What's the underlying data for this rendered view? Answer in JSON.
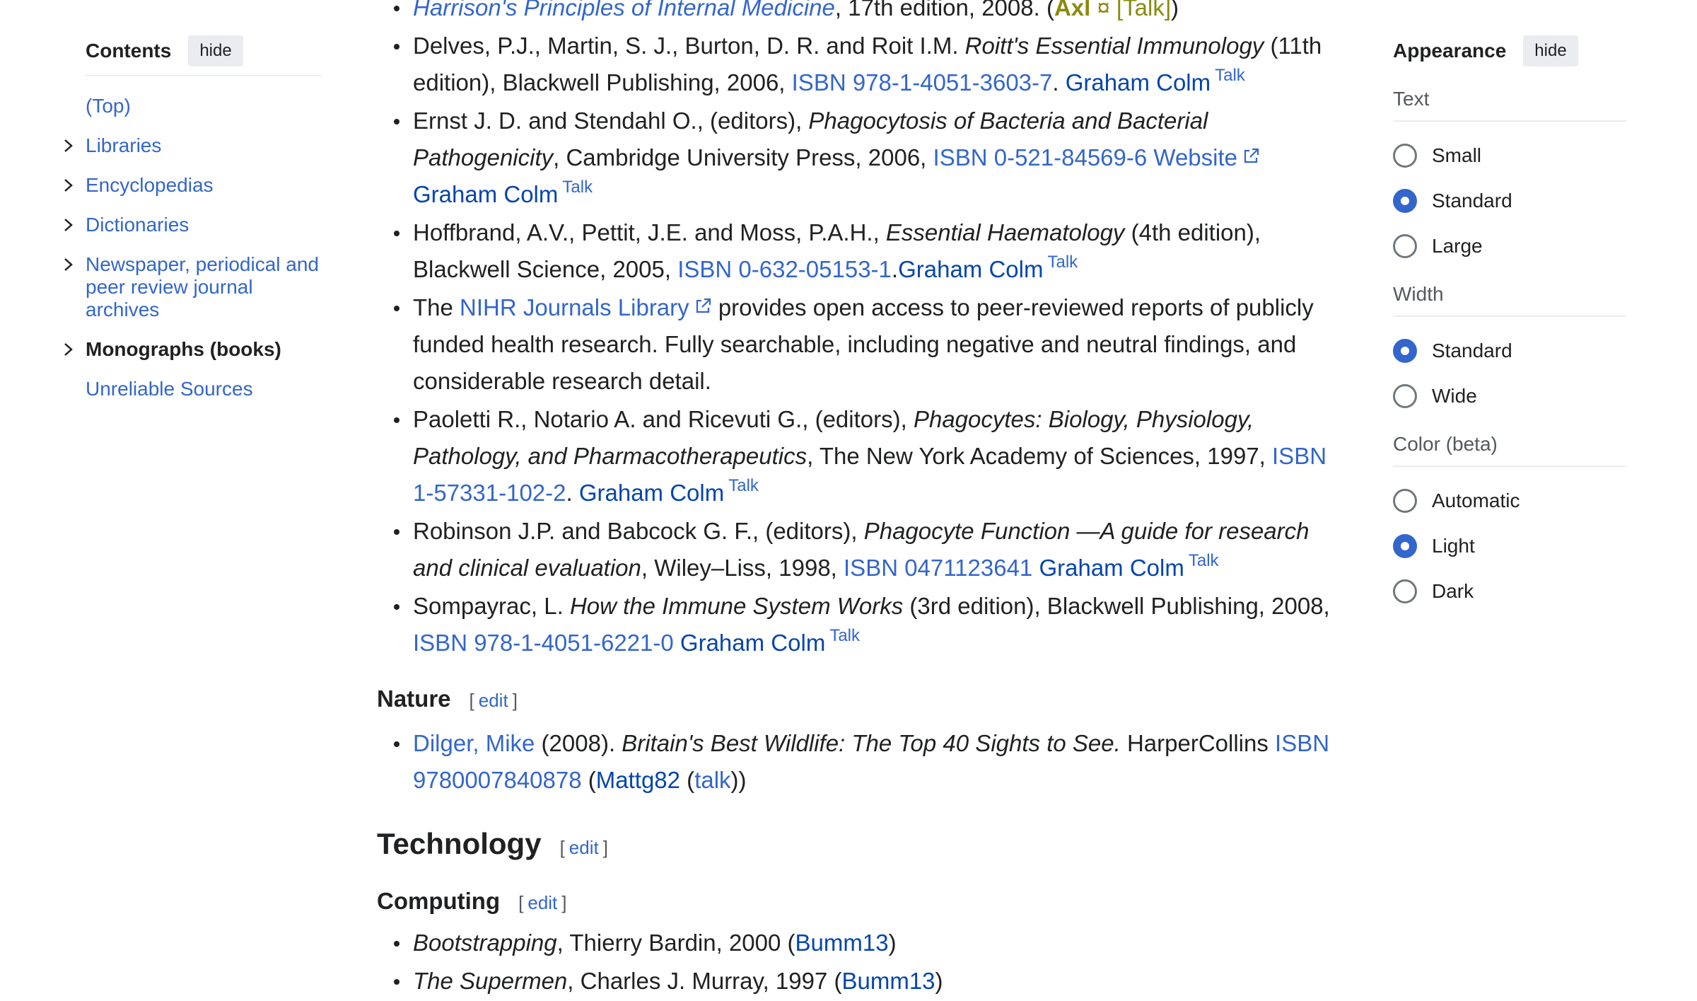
{
  "toc": {
    "title": "Contents",
    "hide_label": "hide",
    "items": [
      {
        "label": "(Top)"
      },
      {
        "label": "Libraries"
      },
      {
        "label": "Encyclopedias"
      },
      {
        "label": "Dictionaries"
      },
      {
        "label": "Newspaper, periodical and peer review journal archives"
      },
      {
        "label": "Monographs (books)"
      },
      {
        "label": "Unreliable Sources"
      }
    ]
  },
  "refs_top": {
    "r0": {
      "title": "Harrison's Principles of Internal Medicine",
      "after": ", 17th edition, 2008. (",
      "user": "Axl",
      "sep": " ¤ ",
      "talk": "[Talk]",
      "close": ")"
    },
    "r1": {
      "pre": "Delves, P.J., Martin, S. J., Burton, D. R. and Roit I.M. ",
      "title": "Roitt's Essential Immunology",
      "mid": " (11th edition), Blackwell Publishing, 2006, ",
      "isbn": "ISBN 978-1-4051-3603-7",
      "dot": ". ",
      "user": "Graham Colm",
      "talk": "Talk"
    },
    "r2": {
      "pre": "Ernst J. D. and Stendahl O., (editors), ",
      "title": "Phagocytosis of Bacteria and Bacterial Pathogenicity",
      "mid": ", Cambridge University Press, 2006, ",
      "isbn": "ISBN 0-521-84569-6",
      "website": "Website",
      "user": "Graham Colm",
      "talk": "Talk"
    },
    "r3": {
      "pre": "Hoffbrand, A.V., Pettit, J.E. and Moss, P.A.H., ",
      "title": "Essential Haematology",
      "mid": " (4th edition), Blackwell Science, 2005, ",
      "isbn": "ISBN 0-632-05153-1",
      "dot": ".",
      "user": "Graham Colm",
      "talk": "Talk"
    },
    "r4": {
      "pre": "The ",
      "link": "NIHR Journals Library",
      "post": " provides open access to peer-reviewed reports of publicly funded health research. Fully searchable, including negative and neutral findings, and considerable research detail."
    },
    "r5": {
      "pre": "Paoletti R., Notario A. and Ricevuti G., (editors), ",
      "title": "Phagocytes: Biology, Physiology, Pathology, and Pharmacotherapeutics",
      "mid": ", The New York Academy of Sciences, 1997, ",
      "isbn": "ISBN 1-57331-102-2",
      "dot": ". ",
      "user": "Graham Colm",
      "talk": "Talk"
    },
    "r6": {
      "pre": "Robinson J.P. and Babcock G. F., (editors), ",
      "title": "Phagocyte Function —A guide for research and clinical evaluation",
      "mid": ", Wiley–Liss, 1998, ",
      "isbn": "ISBN 0471123641",
      "user": "Graham Colm",
      "talk": "Talk"
    },
    "r7": {
      "pre": "Sompayrac, L. ",
      "title": "How the Immune System Works",
      "mid": " (3rd edition), Blackwell Publishing, 2008, ",
      "isbn": "ISBN 978-1-4051-6221-0",
      "user": "Graham Colm",
      "talk": "Talk"
    }
  },
  "nature": {
    "heading": "Nature",
    "edit_label": "edit",
    "r0": {
      "author": "Dilger, Mike",
      "mid": " (2008). ",
      "title": "Britain's Best Wildlife: The Top 40 Sights to See.",
      "post": " HarperCollins ",
      "isbn": "ISBN 9780007840878",
      "open": " (",
      "user": "Mattg82",
      "open2": " (",
      "talk": "talk",
      "close": "))"
    }
  },
  "technology": {
    "heading": "Technology",
    "edit_label": "edit"
  },
  "computing": {
    "heading": "Computing",
    "edit_label": "edit",
    "r0": {
      "title": "Bootstrapping",
      "post": ", Thierry Bardin, 2000 (",
      "user": "Bumm13",
      "close": ")"
    },
    "r1": {
      "title": "The Supermen",
      "post": ", Charles J. Murray, 1997 (",
      "user": "Bumm13",
      "close": ")"
    }
  },
  "appearance": {
    "title": "Appearance",
    "hide_label": "hide",
    "text_label": "Text",
    "text_options": [
      {
        "label": "Small"
      },
      {
        "label": "Standard"
      },
      {
        "label": "Large"
      }
    ],
    "text_selected": "Standard",
    "width_label": "Width",
    "width_options": [
      {
        "label": "Standard"
      },
      {
        "label": "Wide"
      }
    ],
    "width_selected": "Standard",
    "color_label": "Color (beta)",
    "color_options": [
      {
        "label": "Automatic"
      },
      {
        "label": "Light"
      },
      {
        "label": "Dark"
      }
    ],
    "color_selected": "Light"
  },
  "colors": {
    "link": "#3366cc",
    "user_link": "#0645ad",
    "axl": "#8a8a0f",
    "radio_selected": "#3366cc"
  }
}
